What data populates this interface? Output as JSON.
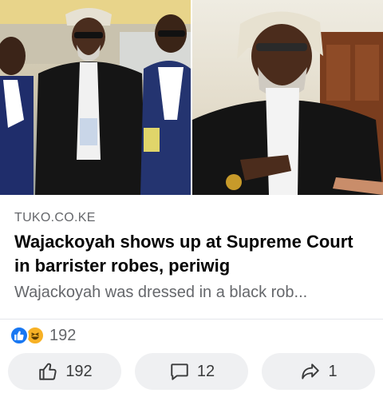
{
  "post": {
    "link": {
      "domain": "TUKO.CO.KE",
      "title": "Wajackoyah shows up at Supreme Court in barrister robes, periwig",
      "description": "Wajackoyah was dressed in a black rob..."
    },
    "reactions": {
      "types": [
        "like-icon",
        "haha-icon"
      ],
      "count": "192"
    },
    "actions": {
      "like_count": "192",
      "comment_count": "12",
      "share_count": "1"
    }
  },
  "colors": {
    "like_blue": "#1877f2",
    "haha_yellow": "#f7b125",
    "muted_text": "#65676b",
    "button_bg": "#eff0f2"
  }
}
